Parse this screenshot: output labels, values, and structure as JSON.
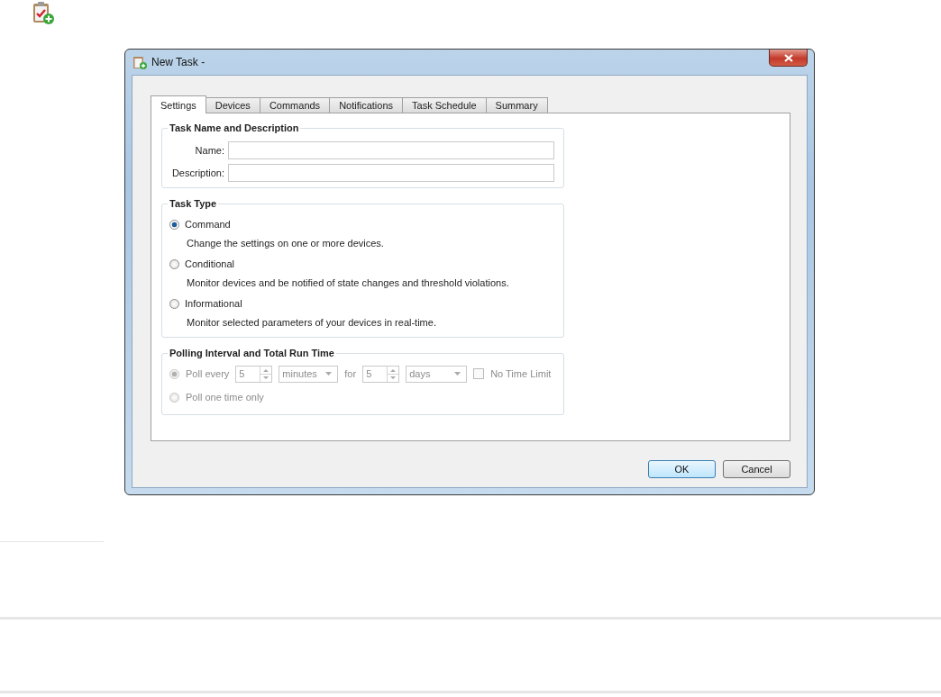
{
  "window": {
    "title": "New Task -"
  },
  "tabs": [
    {
      "label": "Settings",
      "selected": true
    },
    {
      "label": "Devices",
      "selected": false
    },
    {
      "label": "Commands",
      "selected": false
    },
    {
      "label": "Notifications",
      "selected": false
    },
    {
      "label": "Task Schedule",
      "selected": false
    },
    {
      "label": "Summary",
      "selected": false
    }
  ],
  "name_group": {
    "title": "Task Name and Description",
    "fields": [
      {
        "label": "Name:"
      },
      {
        "label": "Description:"
      }
    ]
  },
  "type_group": {
    "title": "Task Type",
    "options": [
      {
        "label": "Command",
        "description": "Change the settings on one or more devices.",
        "selected": true
      },
      {
        "label": "Conditional",
        "description": "Monitor devices and be notified of state changes and threshold violations.",
        "selected": false
      },
      {
        "label": "Informational",
        "description": "Monitor selected parameters of your devices in real-time.",
        "selected": false
      }
    ]
  },
  "polling_group": {
    "title": "Polling Interval and Total Run Time",
    "disabled": true,
    "poll_every": {
      "label": "Poll every",
      "selected": true,
      "interval": "5",
      "interval_unit": "minutes",
      "for_label": "for",
      "duration": "5",
      "duration_unit": "days"
    },
    "no_time_limit": {
      "label": "No Time Limit",
      "checked": false
    },
    "poll_once": {
      "label": "Poll one time only",
      "selected": false
    }
  },
  "buttons": [
    {
      "label": "OK",
      "default": true
    },
    {
      "label": "Cancel",
      "default": false
    }
  ]
}
